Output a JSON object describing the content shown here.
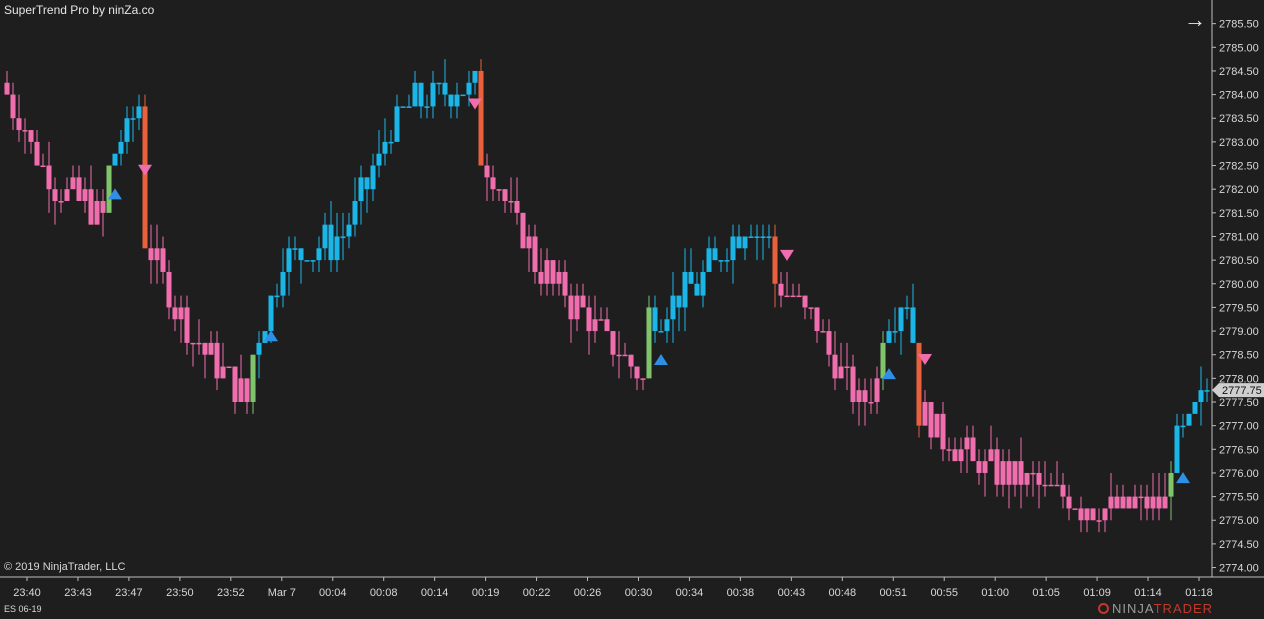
{
  "window": {
    "title": "SuperTrend Pro by ninZa.co",
    "copyright": "© 2019 NinjaTrader, LLC",
    "instrument": "ES 06-19",
    "logo_text_prefix": "NINJA",
    "logo_text_suffix": "TRADER",
    "nav_icon": "arrow-right-icon"
  },
  "colors": {
    "background": "#1e1e1e",
    "text": "#d8d8d8",
    "uptrend": "#1bb5e8",
    "downtrend": "#f06ead",
    "reversal_up_bar": "#7fc36b",
    "reversal_down_bar": "#e8603c",
    "buy_marker": "#2e8fe6",
    "sell_marker": "#f06ead",
    "price_marker_bg": "#cfcfcf"
  },
  "chart_data": {
    "type": "bar",
    "subtype": "ohlc",
    "indicator": "SuperTrend Pro",
    "y_axis": {
      "position": "right",
      "range": [
        2773.8,
        2786.0
      ],
      "ticks": [
        "2774.00",
        "2774.50",
        "2775.00",
        "2775.50",
        "2776.00",
        "2776.50",
        "2777.00",
        "2777.50",
        "2778.00",
        "2778.50",
        "2779.00",
        "2779.50",
        "2780.00",
        "2780.50",
        "2781.00",
        "2781.50",
        "2782.00",
        "2782.50",
        "2783.00",
        "2783.50",
        "2784.00",
        "2784.50",
        "2785.00",
        "2785.50"
      ]
    },
    "x_axis": {
      "ticks": [
        "23:40",
        "23:43",
        "23:47",
        "23:50",
        "23:52",
        "Mar 7",
        "00:04",
        "00:08",
        "00:14",
        "00:19",
        "00:22",
        "00:26",
        "00:30",
        "00:34",
        "00:38",
        "00:43",
        "00:48",
        "00:51",
        "00:55",
        "01:00",
        "01:05",
        "01:09",
        "01:14",
        "01:18"
      ]
    },
    "last_price": "2777.75",
    "grid": false,
    "segments": [
      {
        "trend": "down",
        "points": [
          [
            0,
            2784.0
          ],
          [
            8,
            2782.0
          ],
          [
            16,
            2781.5
          ]
        ]
      },
      {
        "trend": "up",
        "points": [
          [
            17,
            2782.5
          ],
          [
            22,
            2783.7
          ]
        ]
      },
      {
        "trend": "down",
        "points": [
          [
            23,
            2781.0
          ],
          [
            30,
            2779.0
          ],
          [
            40,
            2777.5
          ]
        ]
      },
      {
        "trend": "up",
        "points": [
          [
            41,
            2778.5
          ],
          [
            46,
            2780.5
          ],
          [
            56,
            2781.0
          ],
          [
            65,
            2783.5
          ],
          [
            70,
            2784.0
          ],
          [
            78,
            2784.2
          ]
        ]
      },
      {
        "trend": "down",
        "points": [
          [
            79,
            2782.8
          ],
          [
            88,
            2780.5
          ],
          [
            98,
            2779.0
          ],
          [
            106,
            2778.0
          ]
        ]
      },
      {
        "trend": "up",
        "points": [
          [
            107,
            2779.3
          ],
          [
            115,
            2780.0
          ],
          [
            123,
            2781.3
          ],
          [
            127,
            2780.8
          ]
        ]
      },
      {
        "trend": "down",
        "points": [
          [
            128,
            2780.0
          ],
          [
            134,
            2779.3
          ],
          [
            142,
            2777.5
          ],
          [
            145,
            2778.0
          ]
        ]
      },
      {
        "trend": "up",
        "points": [
          [
            146,
            2779.0
          ],
          [
            150,
            2779.8
          ],
          [
            151,
            2778.9
          ]
        ]
      },
      {
        "trend": "down",
        "points": [
          [
            152,
            2777.3
          ],
          [
            160,
            2776.3
          ],
          [
            170,
            2775.8
          ],
          [
            180,
            2775.3
          ],
          [
            193,
            2775.3
          ]
        ]
      },
      {
        "trend": "up",
        "points": [
          [
            194,
            2776.3
          ],
          [
            200,
            2777.8
          ]
        ]
      }
    ],
    "signals": [
      {
        "type": "buy",
        "bar": 18,
        "price": 2781.9
      },
      {
        "type": "sell",
        "bar": 23,
        "price": 2782.4
      },
      {
        "type": "buy",
        "bar": 44,
        "price": 2778.9
      },
      {
        "type": "sell",
        "bar": 78,
        "price": 2783.8
      },
      {
        "type": "buy",
        "bar": 109,
        "price": 2778.4
      },
      {
        "type": "sell",
        "bar": 130,
        "price": 2780.6
      },
      {
        "type": "buy",
        "bar": 147,
        "price": 2778.1
      },
      {
        "type": "sell",
        "bar": 153,
        "price": 2778.4
      },
      {
        "type": "buy",
        "bar": 196,
        "price": 2775.9
      }
    ]
  }
}
